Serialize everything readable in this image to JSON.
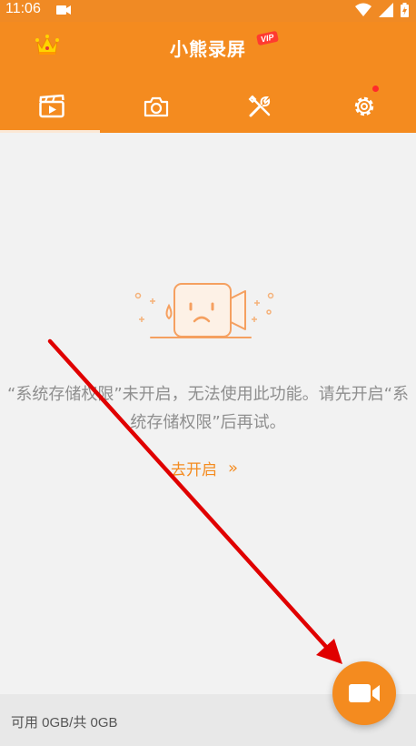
{
  "status_bar": {
    "time": "11:06"
  },
  "header": {
    "title": "小熊录屏",
    "vip_badge": "VIP"
  },
  "tabs": [
    {
      "name": "videos",
      "icon": "video-clapper-icon",
      "active": true
    },
    {
      "name": "screenshots",
      "icon": "camera-icon",
      "active": false
    },
    {
      "name": "tools",
      "icon": "tools-icon",
      "active": false
    },
    {
      "name": "settings",
      "icon": "gear-icon",
      "active": false,
      "has_notification_dot": true
    }
  ],
  "main": {
    "permission_message": "“系统存储权限”未开启，无法使用此功能。请先开启“系统存储权限”后再试。",
    "goto_open_label": "去开启",
    "goto_open_chevron": "»"
  },
  "footer": {
    "storage": "可用 0GB/共 0GB"
  },
  "colors": {
    "accent": "#f48b1f",
    "background": "#f2f2f2",
    "message": "#8e8e8e",
    "arrow": "#e00000"
  }
}
